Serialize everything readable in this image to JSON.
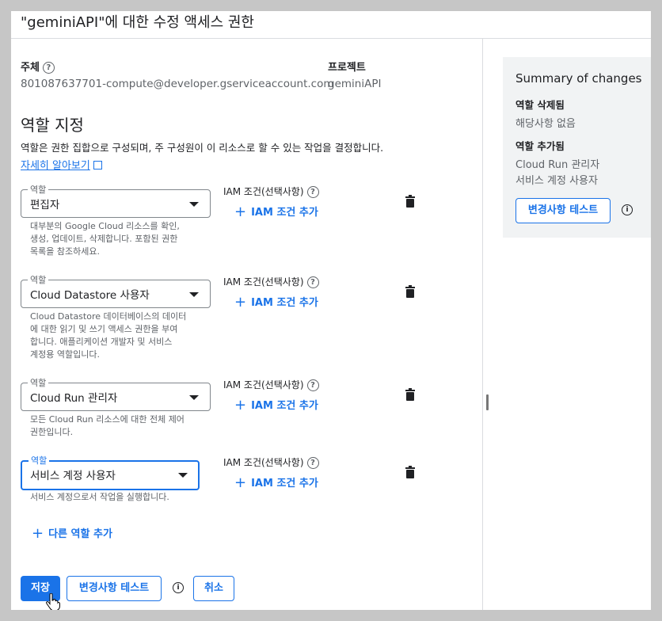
{
  "dialog": {
    "title": "\"geminiAPI\"에 대한 수정 액세스 권한"
  },
  "principal": {
    "label": "주체",
    "value": "801087637701-compute@developer.gserviceaccount.com"
  },
  "project": {
    "label": "프로젝트",
    "value": "geminiAPI"
  },
  "roles_section": {
    "title": "역할 지정",
    "description": "역할은 권한 집합으로 구성되며, 주 구성원이 이 리소스로 할 수 있는 작업을 결정합니다.",
    "learn_more": "자세히 알아보기"
  },
  "role_rows": [
    {
      "field_label": "역할",
      "value": "편집자",
      "desc_lines": [
        "대부분의 Google Cloud 리소스를 확인,",
        "생성, 업데이트, 삭제합니다. 포함된 권한",
        "목록을 참조하세요."
      ],
      "iam_label": "IAM 조건(선택사항)",
      "iam_add": "IAM 조건 추가"
    },
    {
      "field_label": "역할",
      "value": "Cloud Datastore 사용자",
      "desc_lines": [
        "Cloud Datastore 데이터베이스의 데이터",
        "에 대한 읽기 및 쓰기 액세스 권한을 부여",
        "합니다. 애플리케이션 개발자 및 서비스",
        "계정용 역할입니다."
      ],
      "iam_label": "IAM 조건(선택사항)",
      "iam_add": "IAM 조건 추가"
    },
    {
      "field_label": "역할",
      "value": "Cloud Run 관리자",
      "desc_lines": [
        "모든 Cloud Run 리소스에 대한 전체 제어",
        "권한입니다."
      ],
      "iam_label": "IAM 조건(선택사항)",
      "iam_add": "IAM 조건 추가"
    },
    {
      "field_label": "역할",
      "value": "서비스 계정 사용자",
      "desc_lines": [
        "서비스 계정으로서 작업을 실행합니다."
      ],
      "iam_label": "IAM 조건(선택사항)",
      "iam_add": "IAM 조건 추가"
    }
  ],
  "add_role": "다른 역할 추가",
  "footer": {
    "save": "저장",
    "test": "변경사항 테스트",
    "cancel": "취소"
  },
  "summary": {
    "title": "Summary of changes",
    "removed_label": "역할 삭제됨",
    "removed_value": "해당사항 없음",
    "added_label": "역할 추가됨",
    "added_values": [
      "Cloud Run 관리자",
      "서비스 계정 사용자"
    ],
    "test_button": "변경사항 테스트"
  },
  "colors": {
    "accent": "#1a73e8",
    "summary_bg": "#f1f3f4",
    "text_secondary": "#5f6368"
  }
}
